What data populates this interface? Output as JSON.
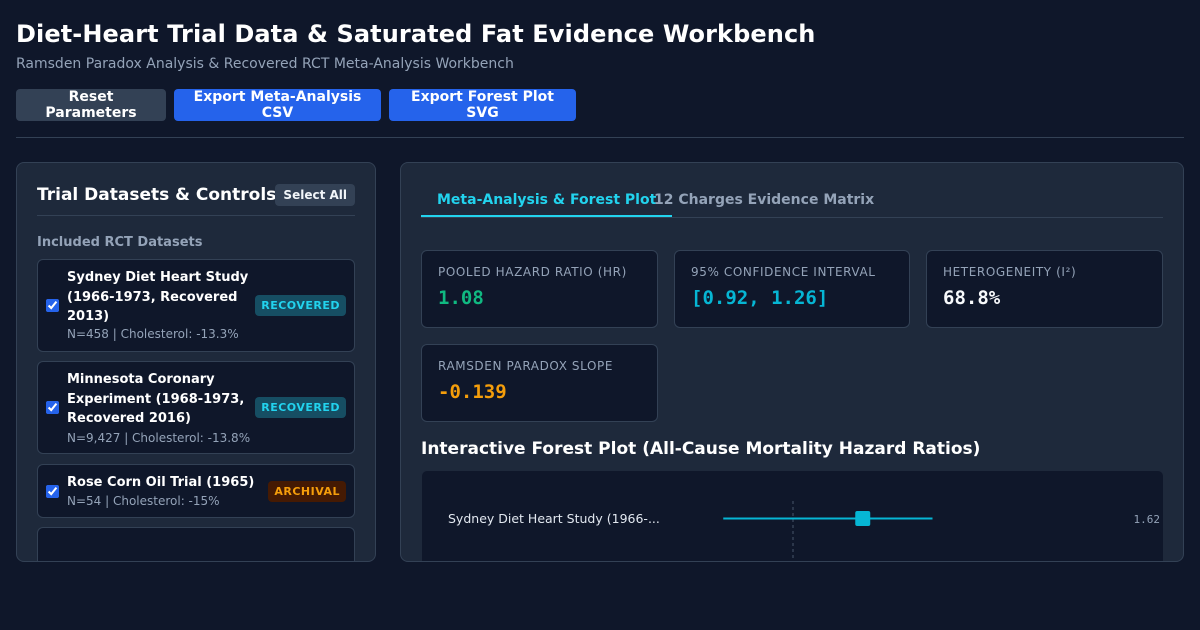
{
  "header": {
    "title": "Diet-Heart Trial Data & Saturated Fat Evidence Workbench",
    "subtitle": "Ramsden Paradox Analysis & Recovered RCT Meta-Analysis Workbench"
  },
  "toolbar": {
    "reset_label": "Reset Parameters",
    "export_csv_label": "Export Meta-Analysis CSV",
    "export_svg_label": "Export Forest Plot SVG"
  },
  "sidebar": {
    "title": "Trial Datasets & Controls",
    "select_all_label": "Select All",
    "section_label": "Included RCT Datasets",
    "trials": [
      {
        "name_lines": [
          "Sydney Diet Heart Study",
          "(1966-1973, Recovered",
          "2013)"
        ],
        "meta": "N=458 | Cholesterol: -13.3%",
        "badge": "RECOVERED",
        "checked": true
      },
      {
        "name_lines": [
          "Minnesota Coronary",
          "Experiment (1968-1973,",
          "Recovered 2016)"
        ],
        "meta": "N=9,427 | Cholesterol: -13.8%",
        "badge": "RECOVERED",
        "checked": true
      },
      {
        "name_lines": [
          "Rose Corn Oil Trial (1965)"
        ],
        "meta": "N=54 | Cholesterol: -15%",
        "badge": "ARCHIVAL",
        "checked": true
      }
    ]
  },
  "main": {
    "tabs": [
      {
        "label": "Meta-Analysis & Forest Plot",
        "active": true
      },
      {
        "label": "12 Charges Evidence Matrix",
        "active": false
      }
    ],
    "stats": [
      {
        "label": "POOLED HAZARD RATIO (HR)",
        "value": "1.08",
        "color": "#10b981"
      },
      {
        "label": "95% CONFIDENCE INTERVAL",
        "value": "[0.92, 1.26]",
        "color": "#06b6d4"
      },
      {
        "label": "HETEROGENEITY (I²)",
        "value": "68.8%",
        "color": "#f8fafc"
      },
      {
        "label": "RAMSDEN PARADOX SLOPE",
        "value": "-0.139",
        "color": "#f59e0b"
      }
    ],
    "forest_title": "Interactive Forest Plot (All-Cause Mortality Hazard Ratios)",
    "forest_rows": [
      {
        "label": "Sydney Diet Heart Study (1966-...",
        "hr": 1.0,
        "ci_low": 0.69,
        "ci_high": 1.62,
        "hr_text": "1.62"
      }
    ]
  },
  "colors": {
    "accent": "#22d3ee",
    "primary": "#2563eb",
    "recovered_badge": "#22d3ee",
    "archival_badge": "#f59e0b"
  }
}
